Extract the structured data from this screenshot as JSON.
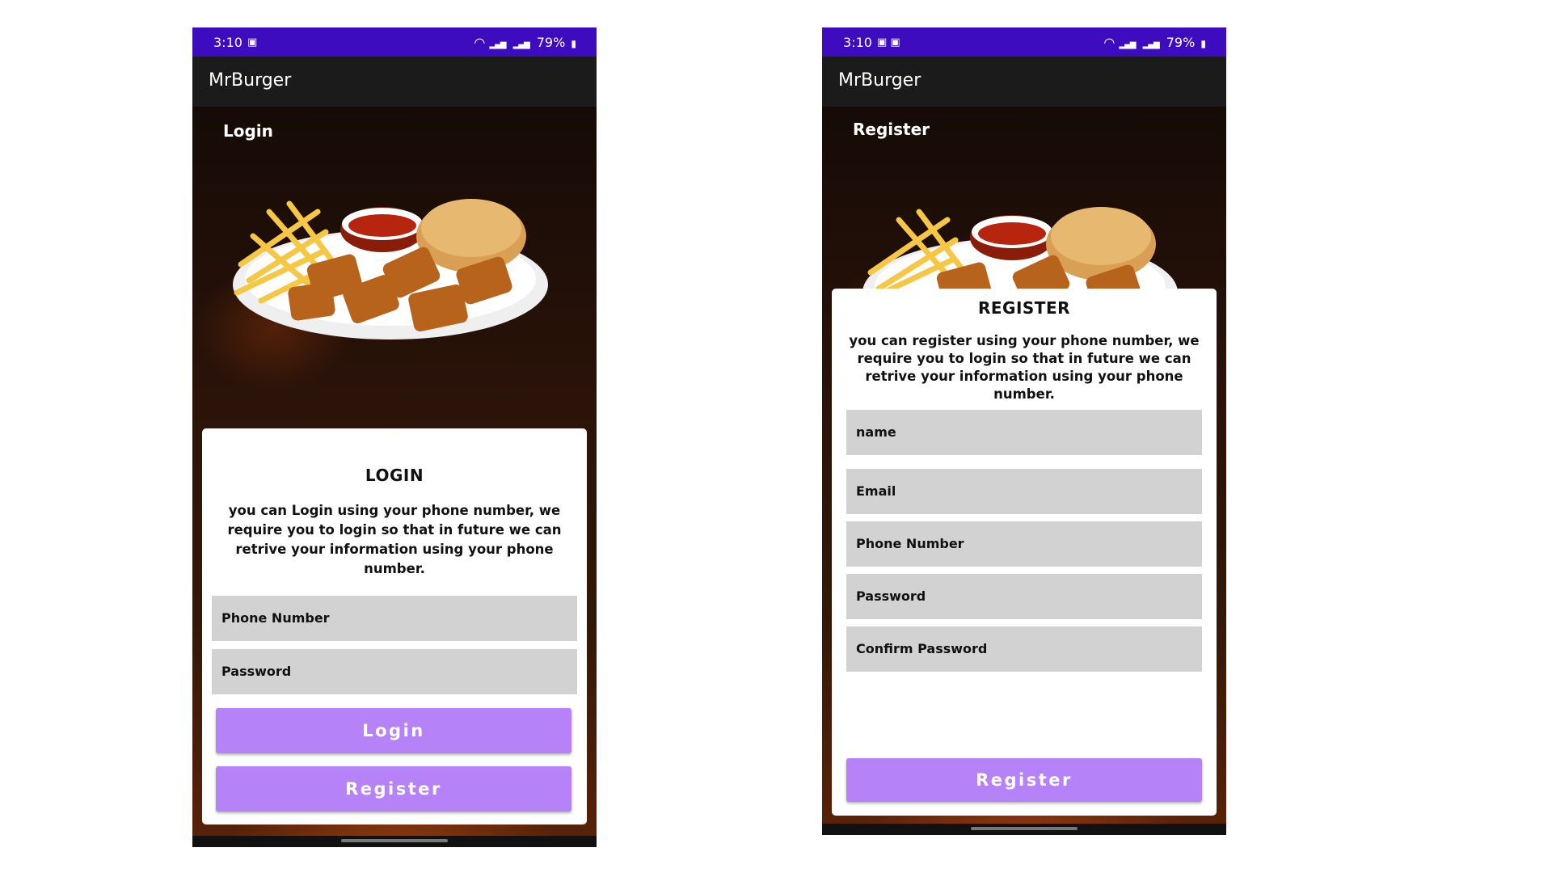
{
  "login_screen": {
    "status_bar": {
      "time": "3:10",
      "battery": "79%"
    },
    "app_title": "MrBurger",
    "section_title": "Login",
    "card": {
      "title": "LOGIN",
      "description": "you can Login using your phone number, we require you to login so that in future we can retrive your information using your phone number.",
      "fields": [
        {
          "placeholder": "Phone Number"
        },
        {
          "placeholder": "Password"
        }
      ],
      "login_button": "Login",
      "register_button": "Register"
    }
  },
  "register_screen": {
    "status_bar": {
      "time": "3:10",
      "battery": "79%"
    },
    "app_title": "MrBurger",
    "section_title": "Register",
    "card": {
      "title": "REGISTER",
      "description": "you can register using your phone number, we require you to login so that in future we can retrive your information using your phone number.",
      "fields": [
        {
          "placeholder": "name"
        },
        {
          "placeholder": "Email"
        },
        {
          "placeholder": "Phone Number"
        },
        {
          "placeholder": "Password"
        },
        {
          "placeholder": "Confirm Password"
        }
      ],
      "register_button": "Register"
    }
  },
  "colors": {
    "status_bar": "#3d0cbe",
    "app_bar": "#1b1b1b",
    "button": "#b682f7",
    "field": "#d2d2d2"
  }
}
